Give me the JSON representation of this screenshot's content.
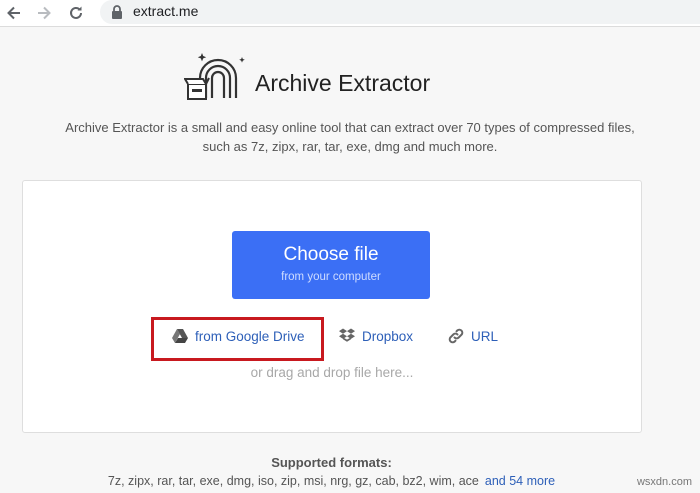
{
  "browser": {
    "url": "extract.me"
  },
  "header": {
    "title": "Archive Extractor",
    "description": "Archive Extractor is a small and easy online tool that can extract over 70 types of compressed files, such as 7z, zipx, rar, tar, exe, dmg and much more."
  },
  "upload": {
    "choose_label": "Choose file",
    "choose_sublabel": "from your computer",
    "sources": [
      {
        "label": "from Google Drive",
        "icon": "google-drive-icon"
      },
      {
        "label": "Dropbox",
        "icon": "dropbox-icon"
      },
      {
        "label": "URL",
        "icon": "link-icon"
      }
    ],
    "drop_hint": "or drag and drop file here...",
    "highlight_color": "#c8191f",
    "button_color": "#3b6ff5"
  },
  "formats": {
    "title": "Supported formats:",
    "list": "7z, zipx, rar, tar, exe, dmg, iso, zip, msi, nrg, gz, cab, bz2, wim, ace",
    "more_link": "and 54 more"
  },
  "watermark": "wsxdn.com"
}
